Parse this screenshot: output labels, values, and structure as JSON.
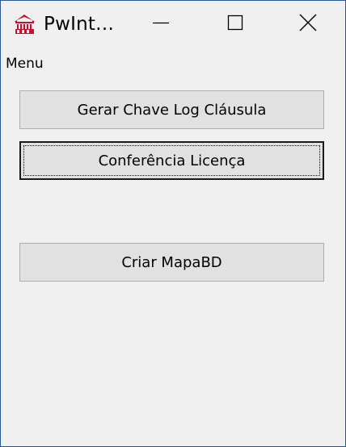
{
  "window": {
    "title": "PwInt…",
    "app_icon": "pwint-app-icon",
    "controls": {
      "minimize_icon": "minimize-icon",
      "maximize_icon": "maximize-icon",
      "close_icon": "close-icon"
    }
  },
  "menu": {
    "label": "Menu"
  },
  "buttons": [
    {
      "label": "Gerar Chave Log Cláusula"
    },
    {
      "label": "Conferência Licença",
      "focused": true
    },
    {
      "label": "Criar MapaBD"
    }
  ],
  "colors": {
    "window_border": "#2b579a",
    "background": "#f0f0f0",
    "button_face": "#e1e1e1",
    "button_border": "#adadad",
    "icon_red": "#c8102e"
  }
}
